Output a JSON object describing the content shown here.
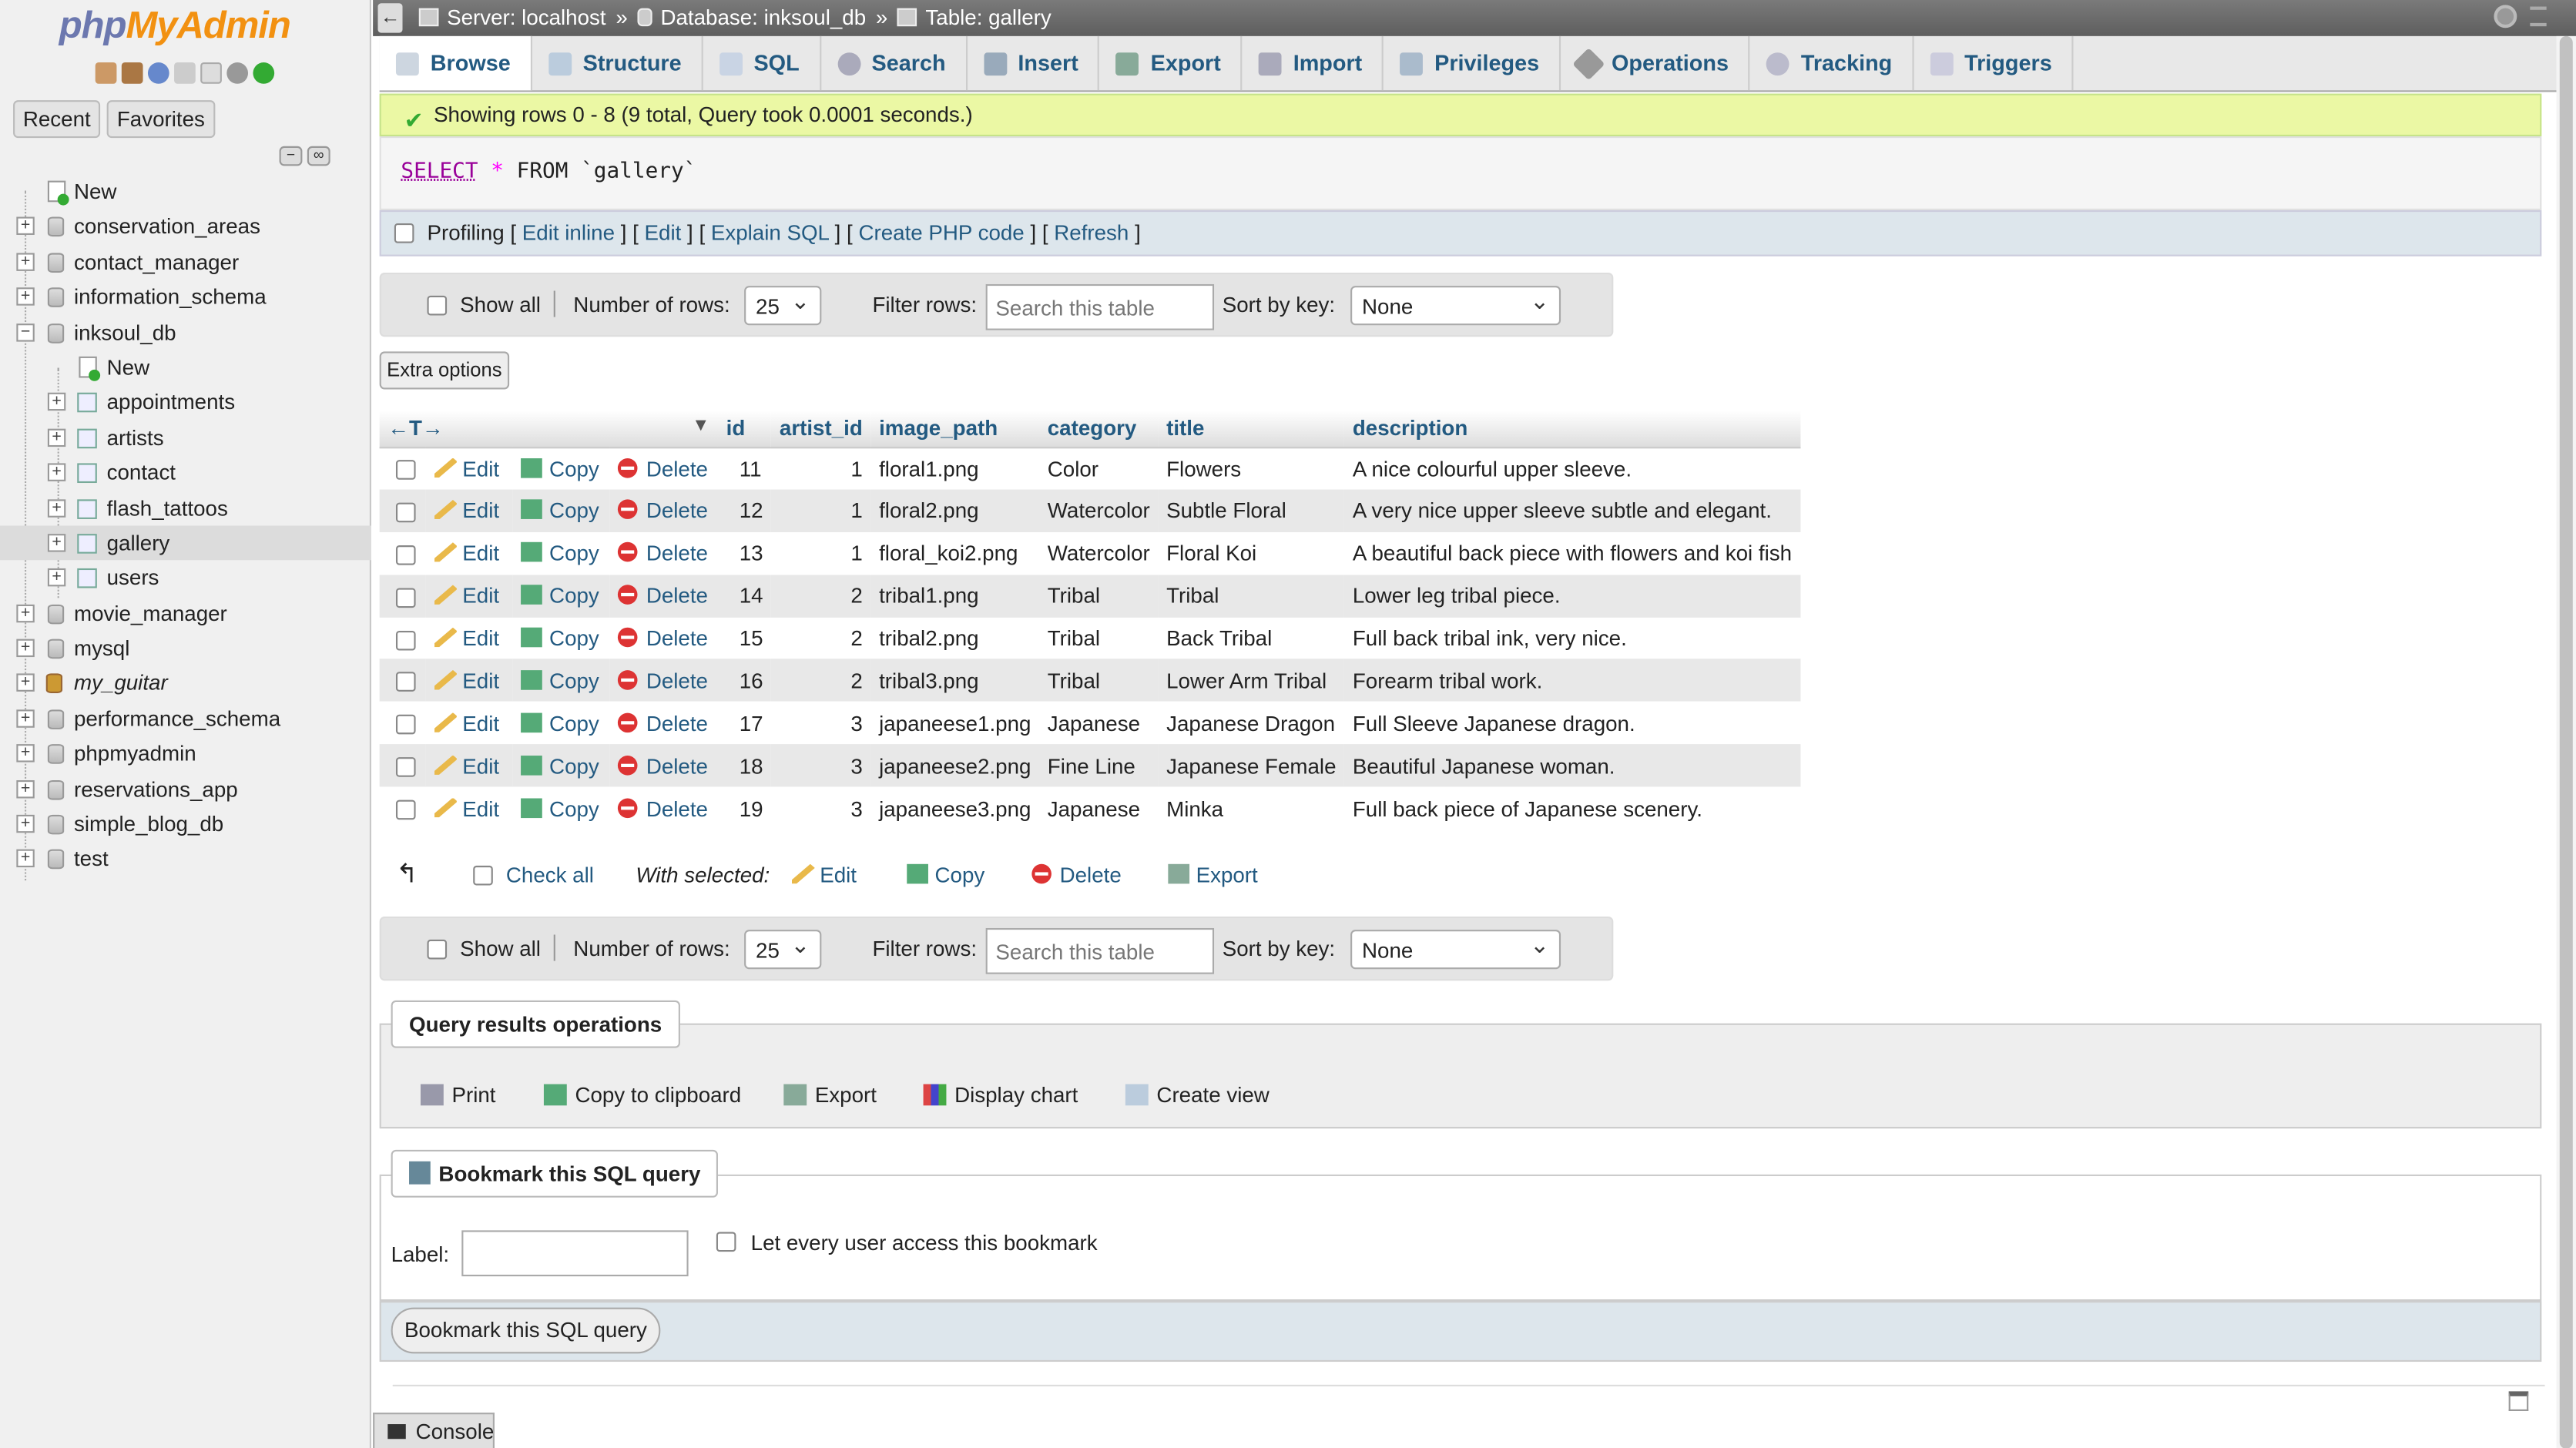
{
  "logo": {
    "php": "php",
    "myadmin": "MyAdmin"
  },
  "sidebar": {
    "tabs": [
      "Recent",
      "Favorites"
    ],
    "new_label": "New",
    "databases": [
      {
        "name": "conservation_areas"
      },
      {
        "name": "contact_manager"
      },
      {
        "name": "information_schema"
      },
      {
        "name": "inksoul_db",
        "expanded": true
      },
      {
        "name": "movie_manager"
      },
      {
        "name": "mysql"
      },
      {
        "name": "my_guitar"
      },
      {
        "name": "performance_schema"
      },
      {
        "name": "phpmyadmin"
      },
      {
        "name": "reservations_app"
      },
      {
        "name": "simple_blog_db"
      },
      {
        "name": "test"
      }
    ],
    "inksoul_children": [
      "New",
      "appointments",
      "artists",
      "contact",
      "flash_tattoos",
      "gallery",
      "users"
    ]
  },
  "breadcrumb": {
    "server": "Server: localhost",
    "database": "Database: inksoul_db",
    "table": "Table: gallery",
    "separator": "»"
  },
  "tabs": [
    "Browse",
    "Structure",
    "SQL",
    "Search",
    "Insert",
    "Export",
    "Import",
    "Privileges",
    "Operations",
    "Tracking",
    "Triggers"
  ],
  "success_message": "Showing rows 0 - 8 (9 total, Query took 0.0001 seconds.)",
  "sql": {
    "kw_select": "SELECT",
    "star": "*",
    "kw_from": "FROM",
    "table": "`gallery`"
  },
  "profiling": {
    "label": "Profiling",
    "links": [
      "Edit inline",
      "Edit",
      "Explain SQL",
      "Create PHP code",
      "Refresh"
    ]
  },
  "nav": {
    "show_all": "Show all",
    "num_rows_label": "Number of rows:",
    "num_rows_value": "25",
    "filter_label": "Filter rows:",
    "filter_placeholder": "Search this table",
    "sort_label": "Sort by key:",
    "sort_value": "None"
  },
  "extra_options": "Extra options",
  "table": {
    "columns": [
      "id",
      "artist_id",
      "image_path",
      "category",
      "title",
      "description"
    ],
    "actions": {
      "edit": "Edit",
      "copy": "Copy",
      "delete": "Delete"
    },
    "rows": [
      {
        "id": "11",
        "artist_id": "1",
        "image_path": "floral1.png",
        "category": "Color",
        "title": "Flowers",
        "description": "A nice colourful upper sleeve."
      },
      {
        "id": "12",
        "artist_id": "1",
        "image_path": "floral2.png",
        "category": "Watercolor",
        "title": "Subtle Floral",
        "description": "A very nice upper sleeve subtle and elegant."
      },
      {
        "id": "13",
        "artist_id": "1",
        "image_path": "floral_koi2.png",
        "category": "Watercolor",
        "title": "Floral Koi",
        "description": "A beautiful back piece with flowers and koi fish"
      },
      {
        "id": "14",
        "artist_id": "2",
        "image_path": "tribal1.png",
        "category": "Tribal",
        "title": "Tribal",
        "description": "Lower leg tribal piece."
      },
      {
        "id": "15",
        "artist_id": "2",
        "image_path": "tribal2.png",
        "category": "Tribal",
        "title": "Back Tribal",
        "description": "Full back tribal ink, very nice."
      },
      {
        "id": "16",
        "artist_id": "2",
        "image_path": "tribal3.png",
        "category": "Tribal",
        "title": "Lower Arm Tribal",
        "description": "Forearm tribal work."
      },
      {
        "id": "17",
        "artist_id": "3",
        "image_path": "japaneese1.png",
        "category": "Japanese",
        "title": "Japanese Dragon",
        "description": "Full Sleeve Japanese dragon."
      },
      {
        "id": "18",
        "artist_id": "3",
        "image_path": "japaneese2.png",
        "category": "Fine Line",
        "title": "Japanese Female",
        "description": "Beautiful Japanese woman."
      },
      {
        "id": "19",
        "artist_id": "3",
        "image_path": "japaneese3.png",
        "category": "Japanese",
        "title": "Minka",
        "description": "Full back piece of Japanese scenery."
      }
    ]
  },
  "with_selected": {
    "check_all": "Check all",
    "label": "With selected:",
    "edit": "Edit",
    "copy": "Copy",
    "delete": "Delete",
    "export": "Export"
  },
  "query_ops": {
    "legend": "Query results operations",
    "buttons": [
      "Print",
      "Copy to clipboard",
      "Export",
      "Display chart",
      "Create view"
    ]
  },
  "bookmark": {
    "legend": "Bookmark this SQL query",
    "label": "Label:",
    "share": "Let every user access this bookmark",
    "submit": "Bookmark this SQL query"
  },
  "console": "Console"
}
